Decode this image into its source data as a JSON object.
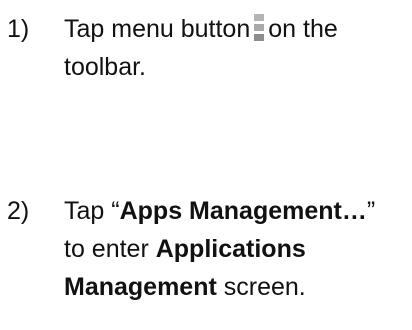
{
  "steps": [
    {
      "number": "1)",
      "text_before_icon": "Tap menu button",
      "icon": "menu-overflow-icon",
      "text_after_icon": "on the",
      "line2": "toolbar."
    },
    {
      "number": "2)",
      "line1_pre": "Tap “",
      "line1_bold": "Apps Management…",
      "line1_post": "”",
      "line2_pre": "to enter ",
      "line2_bold": "Applications",
      "line3_bold": "Management",
      "line3_post": " screen."
    }
  ],
  "colors": {
    "text": "#111111",
    "icon_light": "#b3b3b3",
    "icon_dark": "#8c8c8c"
  }
}
